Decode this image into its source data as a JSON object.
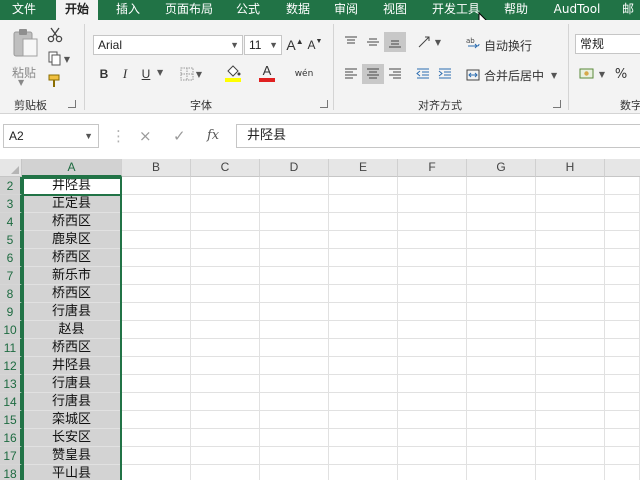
{
  "menu": {
    "tabs": [
      "文件",
      "开始",
      "插入",
      "页面布局",
      "公式",
      "数据",
      "审阅",
      "视图",
      "开发工具",
      "帮助",
      "AudTool",
      "邮"
    ],
    "active_tab": "开始"
  },
  "ribbon": {
    "clipboard": {
      "label": "剪贴板",
      "paste_label": "粘贴"
    },
    "font": {
      "label": "字体",
      "name": "Arial",
      "size": "11",
      "increase": "A",
      "decrease": "A",
      "bold": "B",
      "italic": "I",
      "underline": "U",
      "font_color_glyph": "A",
      "phonetic_glyph": "wén"
    },
    "alignment": {
      "label": "对齐方式",
      "wrap_text": "自动换行",
      "merge_center": "合并后居中"
    },
    "number": {
      "label": "数字",
      "format": "常规",
      "percent": "%"
    }
  },
  "formula_bar": {
    "name_box": "A2",
    "cancel": "×",
    "enter": "✓",
    "fx": "fx",
    "value": "井陉县"
  },
  "grid": {
    "columns": [
      "A",
      "B",
      "C",
      "D",
      "E",
      "F",
      "G",
      "H"
    ],
    "selected_column": "A",
    "rows": [
      {
        "num": "2",
        "a": "井陉县"
      },
      {
        "num": "3",
        "a": "正定县"
      },
      {
        "num": "4",
        "a": "桥西区"
      },
      {
        "num": "5",
        "a": "鹿泉区"
      },
      {
        "num": "6",
        "a": "桥西区"
      },
      {
        "num": "7",
        "a": "新乐市"
      },
      {
        "num": "8",
        "a": "桥西区"
      },
      {
        "num": "9",
        "a": "行唐县"
      },
      {
        "num": "10",
        "a": "赵县"
      },
      {
        "num": "11",
        "a": "桥西区"
      },
      {
        "num": "12",
        "a": "井陉县"
      },
      {
        "num": "13",
        "a": "行唐县"
      },
      {
        "num": "14",
        "a": "行唐县"
      },
      {
        "num": "15",
        "a": "栾城区"
      },
      {
        "num": "16",
        "a": "长安区"
      },
      {
        "num": "17",
        "a": "赞皇县"
      },
      {
        "num": "18",
        "a": "平山县"
      }
    ]
  },
  "colors": {
    "accent": "#217346",
    "selection_fill": "#d3d3d3"
  }
}
